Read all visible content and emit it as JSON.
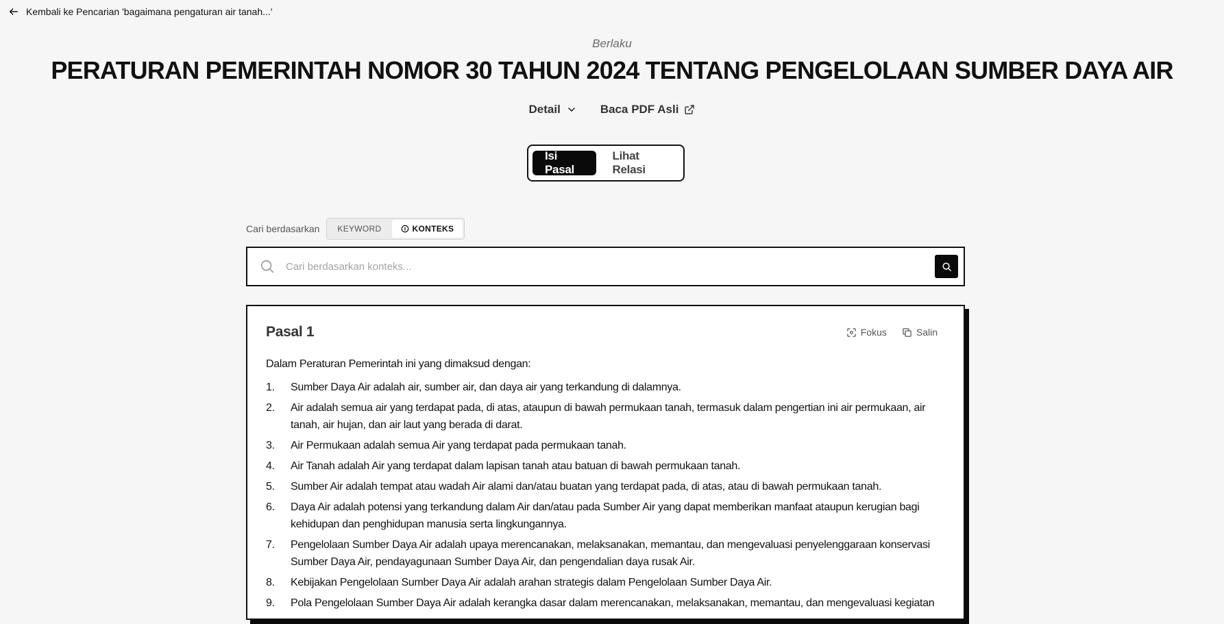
{
  "nav": {
    "back_label": "Kembali ke Pencarian 'bagaimana pengaturan air tanah...'"
  },
  "document": {
    "status": "Berlaku",
    "title": "PERATURAN PEMERINTAH NOMOR 30 TAHUN 2024 TENTANG PENGELOLAAN SUMBER DAYA AIR",
    "detail_label": "Detail",
    "pdf_label": "Baca PDF Asli"
  },
  "tabs": [
    {
      "label": "Isi Pasal",
      "active": true
    },
    {
      "label": "Lihat Relasi",
      "active": false
    }
  ],
  "search": {
    "by_label": "Cari berdasarkan",
    "mode_keyword": "KEYWORD",
    "mode_context": "KONTEKS",
    "active_mode": "KONTEKS",
    "placeholder": "Cari berdasarkan konteks...",
    "value": ""
  },
  "article": {
    "title": "Pasal 1",
    "focus_label": "Fokus",
    "copy_label": "Salin",
    "intro": "Dalam Peraturan Pemerintah ini yang dimaksud dengan:",
    "items": [
      {
        "num": "1.",
        "text": "Sumber Daya Air adalah air, sumber air, dan daya air yang terkandung di dalamnya."
      },
      {
        "num": "2.",
        "text": "Air adalah semua air yang terdapat pada, di atas, ataupun di bawah permukaan tanah, termasuk dalam pengertian ini air permukaan, air tanah, air hujan, dan air laut yang berada di darat."
      },
      {
        "num": "3.",
        "text": "Air Permukaan adalah semua Air yang terdapat pada permukaan tanah."
      },
      {
        "num": "4.",
        "text": "Air Tanah adalah Air yang terdapat dalam lapisan tanah atau batuan di bawah permukaan tanah."
      },
      {
        "num": "5.",
        "text": "Sumber Air adalah tempat atau wadah Air alami dan/atau buatan yang terdapat pada, di atas, atau di bawah permukaan tanah."
      },
      {
        "num": "6.",
        "text": "Daya Air adalah potensi yang terkandung dalam Air dan/atau pada Sumber Air yang dapat memberikan manfaat ataupun kerugian bagi kehidupan dan penghidupan manusia serta lingkungannya."
      },
      {
        "num": "7.",
        "text": "Pengelolaan Sumber Daya Air adalah upaya merencanakan, melaksanakan, memantau, dan mengevaluasi penyelenggaraan konservasi Sumber Daya Air, pendayagunaan Sumber Daya Air, dan pengendalian daya rusak Air."
      },
      {
        "num": "8.",
        "text": "Kebijakan Pengelolaan Sumber Daya Air adalah arahan strategis dalam Pengelolaan Sumber Daya Air."
      },
      {
        "num": "9.",
        "text": "Pola Pengelolaan Sumber Daya Air adalah kerangka dasar dalam merencanakan, melaksanakan, memantau, dan mengevaluasi kegiatan"
      }
    ]
  }
}
